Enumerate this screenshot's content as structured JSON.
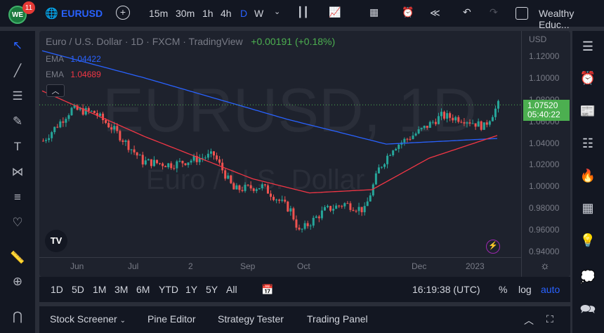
{
  "header": {
    "avatar_text": "WE",
    "notifications": "11",
    "symbol": "EURUSD",
    "intervals": [
      "15m",
      "30m",
      "1h",
      "4h",
      "D",
      "W"
    ],
    "active_interval": "D",
    "layout_name": "Wealthy Educ..."
  },
  "legend": {
    "title": "Euro / U.S. Dollar · 1D · FXCM · TradingView",
    "change": "+0.00191 (+0.18%)",
    "ema1_label": "EMA",
    "ema1_value": "1.04422",
    "ema2_label": "EMA",
    "ema2_value": "1.04689"
  },
  "watermark": {
    "symbol": "EURUSD, 1D",
    "name": "Euro / U.S. Dollar"
  },
  "price_axis": {
    "currency": "USD",
    "ticks": [
      "1.12000",
      "1.10000",
      "1.08000",
      "1.06000",
      "1.04000",
      "1.02000",
      "1.00000",
      "0.98000",
      "0.96000",
      "0.94000"
    ],
    "last_price": "1.07520",
    "countdown": "05:40:22"
  },
  "time_axis": {
    "labels": [
      "Jun",
      "Jul",
      "2",
      "Sep",
      "Oct",
      "Dec",
      "2023"
    ]
  },
  "timeframes": {
    "ranges": [
      "1D",
      "5D",
      "1M",
      "3M",
      "6M",
      "YTD",
      "1Y",
      "5Y",
      "All"
    ],
    "clock": "16:19:38 (UTC)",
    "percent": "%",
    "log": "log",
    "auto": "auto"
  },
  "bottom_panel": {
    "tabs": [
      "Stock Screener",
      "Pine Editor",
      "Strategy Tester",
      "Trading Panel"
    ]
  },
  "colors": {
    "up": "#26a69a",
    "down": "#ef5350",
    "ema_fast": "#2962ff",
    "ema_slow": "#f23645",
    "accent": "#2962ff"
  },
  "chart_data": {
    "type": "candlestick",
    "ylim": [
      0.94,
      1.12
    ],
    "bars": 165,
    "close_keypoints": [
      [
        0,
        1.042
      ],
      [
        10,
        1.071
      ],
      [
        18,
        1.068
      ],
      [
        25,
        1.052
      ],
      [
        35,
        1.023
      ],
      [
        45,
        1.02
      ],
      [
        60,
        1.029
      ],
      [
        67,
        0.997
      ],
      [
        77,
        1.0
      ],
      [
        87,
        0.978
      ],
      [
        90,
        0.958
      ],
      [
        99,
        0.978
      ],
      [
        106,
        0.984
      ],
      [
        113,
        0.978
      ],
      [
        118,
        1.016
      ],
      [
        123,
        1.036
      ],
      [
        133,
        1.052
      ],
      [
        140,
        1.065
      ],
      [
        148,
        1.062
      ],
      [
        155,
        1.055
      ],
      [
        160,
        1.0752
      ]
    ],
    "ema_fast_keypoints": [
      [
        0,
        1.125
      ],
      [
        36,
        1.1
      ],
      [
        86,
        1.062
      ],
      [
        121,
        1.039
      ],
      [
        160,
        1.0442
      ]
    ],
    "ema_slow_keypoints": [
      [
        0,
        1.088
      ],
      [
        36,
        1.046
      ],
      [
        74,
        1.007
      ],
      [
        94,
        0.994
      ],
      [
        116,
        0.997
      ],
      [
        136,
        1.026
      ],
      [
        160,
        1.0469
      ]
    ]
  }
}
